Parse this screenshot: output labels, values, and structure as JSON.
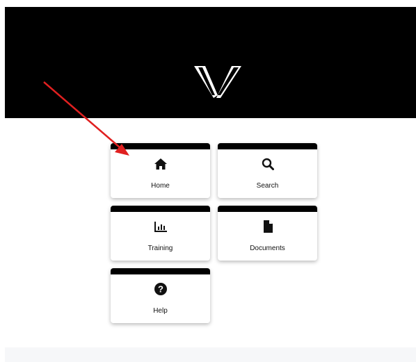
{
  "header": {
    "logo_icon": "v-logo",
    "background": "#000000"
  },
  "tiles": [
    {
      "label": "Home",
      "icon": "home-icon"
    },
    {
      "label": "Search",
      "icon": "search-icon"
    },
    {
      "label": "Training",
      "icon": "chart-icon"
    },
    {
      "label": "Documents",
      "icon": "document-icon"
    },
    {
      "label": "Help",
      "icon": "help-icon"
    }
  ],
  "annotation": {
    "arrow_color": "#e02020"
  }
}
